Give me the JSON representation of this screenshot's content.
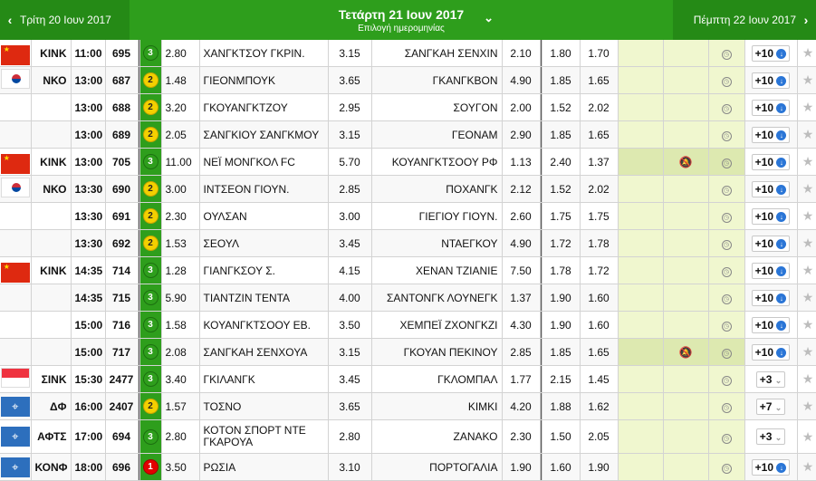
{
  "nav": {
    "prev_label": "Τρίτη 20 Ιουν 2017",
    "current_label": "Τετάρτη 21 Ιουν 2017",
    "current_sub": "Επιλογή ημερομηνίας",
    "next_label": "Πέμπτη 22 Ιουν 2017"
  },
  "rows": [
    {
      "flag": "china-flag",
      "code": "ΚΙΝΚ",
      "time": "11:00",
      "id": "695",
      "sev": "3",
      "odd1": "2.80",
      "home": "ΧΑΝΓΚΤΣΟΥ ΓΚΡΙΝ.",
      "oddx": "3.15",
      "away": "ΣΑΝΓΚΑΗ ΣΕΝΧΙΝ",
      "odd2": "2.10",
      "u": "1.80",
      "o": "1.70",
      "more": "+10",
      "mtype": "arrow"
    },
    {
      "flag": "korea-flag",
      "code": "ΝΚΟ",
      "time": "13:00",
      "id": "687",
      "sev": "2",
      "odd1": "1.48",
      "home": "ΓΙΕΟΝΜΠΟΥΚ",
      "oddx": "3.65",
      "away": "ΓΚΑΝΓΚΒΟΝ",
      "odd2": "4.90",
      "u": "1.85",
      "o": "1.65",
      "more": "+10",
      "mtype": "arrow"
    },
    {
      "flag": "",
      "code": "",
      "time": "13:00",
      "id": "688",
      "sev": "2",
      "odd1": "3.20",
      "home": "ΓΚΟΥΑΝΓΚΤΖΟΥ",
      "oddx": "2.95",
      "away": "ΣΟΥΓΟΝ",
      "odd2": "2.00",
      "u": "1.52",
      "o": "2.02",
      "more": "+10",
      "mtype": "arrow"
    },
    {
      "flag": "",
      "code": "",
      "time": "13:00",
      "id": "689",
      "sev": "2",
      "odd1": "2.05",
      "home": "ΣΑΝΓΚΙΟΥ ΣΑΝΓΚΜΟΥ",
      "oddx": "3.15",
      "away": "ΓΕΟΝΑΜ",
      "odd2": "2.90",
      "u": "1.85",
      "o": "1.65",
      "more": "+10",
      "mtype": "arrow"
    },
    {
      "flag": "china-flag",
      "code": "ΚΙΝΚ",
      "time": "13:00",
      "id": "705",
      "sev": "3",
      "odd1": "11.00",
      "home": "ΝΕΪ ΜΟΝΓΚΟΛ FC",
      "oddx": "5.70",
      "away": "ΚΟΥΑΝΓΚΤΣΟΟΥ ΡΦ",
      "odd2": "1.13",
      "u": "2.40",
      "o": "1.37",
      "more": "+10",
      "mtype": "arrow",
      "muted": true
    },
    {
      "flag": "korea-flag",
      "code": "ΝΚΟ",
      "time": "13:30",
      "id": "690",
      "sev": "2",
      "odd1": "3.00",
      "home": "ΙΝΤΣΕΟΝ ΓΙΟΥΝ.",
      "oddx": "2.85",
      "away": "ΠΟΧΑΝΓΚ",
      "odd2": "2.12",
      "u": "1.52",
      "o": "2.02",
      "more": "+10",
      "mtype": "arrow"
    },
    {
      "flag": "",
      "code": "",
      "time": "13:30",
      "id": "691",
      "sev": "2",
      "odd1": "2.30",
      "home": "ΟΥΛΣΑΝ",
      "oddx": "3.00",
      "away": "ΓΙΕΓΙΟΥ ΓΙΟΥΝ.",
      "odd2": "2.60",
      "u": "1.75",
      "o": "1.75",
      "more": "+10",
      "mtype": "arrow"
    },
    {
      "flag": "",
      "code": "",
      "time": "13:30",
      "id": "692",
      "sev": "2",
      "odd1": "1.53",
      "home": "ΣΕΟΥΛ",
      "oddx": "3.45",
      "away": "ΝΤΑΕΓΚΟΥ",
      "odd2": "4.90",
      "u": "1.72",
      "o": "1.78",
      "more": "+10",
      "mtype": "arrow"
    },
    {
      "flag": "china-flag",
      "code": "ΚΙΝΚ",
      "time": "14:35",
      "id": "714",
      "sev": "3",
      "odd1": "1.28",
      "home": "ΓΙΑΝΓΚΣΟΥ Σ.",
      "oddx": "4.15",
      "away": "ΧΕΝΑΝ ΤΖΙΑΝΙΕ",
      "odd2": "7.50",
      "u": "1.78",
      "o": "1.72",
      "more": "+10",
      "mtype": "arrow"
    },
    {
      "flag": "",
      "code": "",
      "time": "14:35",
      "id": "715",
      "sev": "3",
      "odd1": "5.90",
      "home": "ΤΙΑΝΤΖΙΝ ΤΕΝΤΑ",
      "oddx": "4.00",
      "away": "ΣΑΝΤΟΝΓΚ ΛΟΥΝΕΓΚ",
      "odd2": "1.37",
      "u": "1.90",
      "o": "1.60",
      "more": "+10",
      "mtype": "arrow"
    },
    {
      "flag": "",
      "code": "",
      "time": "15:00",
      "id": "716",
      "sev": "3",
      "odd1": "1.58",
      "home": "ΚΟΥΑΝΓΚΤΣΟΟΥ ΕΒ.",
      "oddx": "3.50",
      "away": "ΧΕΜΠΕΪ ΖΧΟΝΓΚΖΙ",
      "odd2": "4.30",
      "u": "1.90",
      "o": "1.60",
      "more": "+10",
      "mtype": "arrow"
    },
    {
      "flag": "",
      "code": "",
      "time": "15:00",
      "id": "717",
      "sev": "3",
      "odd1": "2.08",
      "home": "ΣΑΝΓΚΑΗ ΣΕΝΧΟΥΑ",
      "oddx": "3.15",
      "away": "ΓΚΟΥΑΝ ΠΕΚΙΝΟΥ",
      "odd2": "2.85",
      "u": "1.85",
      "o": "1.65",
      "more": "+10",
      "mtype": "arrow",
      "muted": true
    },
    {
      "flag": "singapore-flag",
      "code": "ΣΙΝΚ",
      "time": "15:30",
      "id": "2477",
      "sev": "3",
      "odd1": "3.40",
      "home": "ΓΚΙΛΑΝΓΚ",
      "oddx": "3.45",
      "away": "ΓΚΛΟΜΠΑΛ",
      "odd2": "1.77",
      "u": "2.15",
      "o": "1.45",
      "more": "+3",
      "mtype": "chev"
    },
    {
      "flag": "world-flag",
      "code": "ΔΦ",
      "time": "16:00",
      "id": "2407",
      "sev": "2",
      "odd1": "1.57",
      "home": "ΤΟΣΝΟ",
      "oddx": "3.65",
      "away": "ΚΙΜΚΙ",
      "odd2": "4.20",
      "u": "1.88",
      "o": "1.62",
      "more": "+7",
      "mtype": "chev"
    },
    {
      "flag": "world-flag",
      "code": "ΑΦΤΣ",
      "time": "17:00",
      "id": "694",
      "sev": "3",
      "odd1": "2.80",
      "home": "ΚΟΤΟΝ ΣΠΟΡΤ ΝΤΕ ΓΚΑΡΟΥΑ",
      "oddx": "2.80",
      "away": "ΖΑΝΑΚΟ",
      "odd2": "2.30",
      "u": "1.50",
      "o": "2.05",
      "more": "+3",
      "mtype": "chev",
      "tall": true
    },
    {
      "flag": "world-flag",
      "code": "ΚΟΝΦ",
      "time": "18:00",
      "id": "696",
      "sev": "1",
      "odd1": "3.50",
      "home": "ΡΩΣΙΑ",
      "oddx": "3.10",
      "away": "ΠΟΡΤΟΓΑΛΙΑ",
      "odd2": "1.90",
      "u": "1.60",
      "o": "1.90",
      "more": "+10",
      "mtype": "arrow"
    }
  ]
}
